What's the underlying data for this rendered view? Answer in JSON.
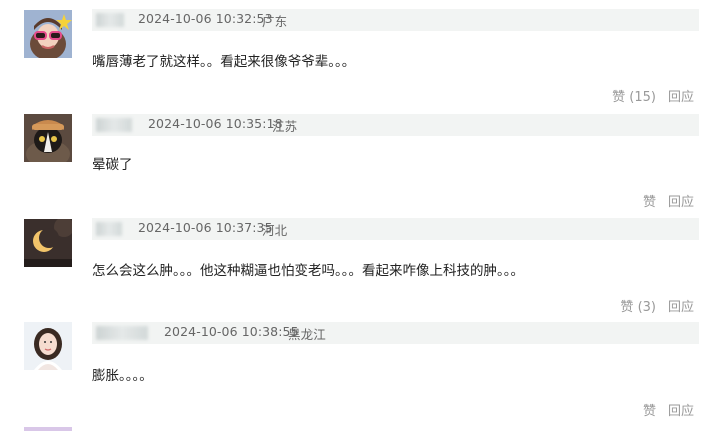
{
  "comments": [
    {
      "timestamp": "2024-10-06 10:32:53",
      "location": "广东",
      "text": "嘴唇薄老了就这样。。看起来很像爷爷辈。。。",
      "like_label": "赞",
      "like_count": "(15)",
      "reply_label": "回应",
      "avatar_icon": "sunglasses-girl-avatar"
    },
    {
      "timestamp": "2024-10-06 10:35:18",
      "location": "江苏",
      "text": "晕碳了",
      "like_label": "赞",
      "like_count": "",
      "reply_label": "回应",
      "avatar_icon": "cat-avatar"
    },
    {
      "timestamp": "2024-10-06 10:37:35",
      "location": "河北",
      "text": "怎么会这么肿。。。他这种糊逼也怕变老吗。。。看起来咋像上科技的肿。。。",
      "like_label": "赞",
      "like_count": "(3)",
      "reply_label": "回应",
      "avatar_icon": "moon-avatar"
    },
    {
      "timestamp": "2024-10-06 10:38:55",
      "location": "黑龙江",
      "text": "膨胀。。。。",
      "like_label": "赞",
      "like_count": "",
      "reply_label": "回应",
      "avatar_icon": "woman-portrait-avatar"
    }
  ]
}
